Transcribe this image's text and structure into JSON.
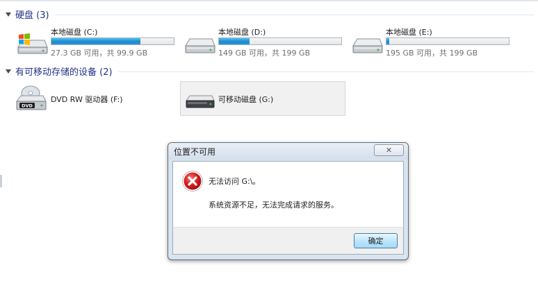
{
  "groups": {
    "hard_disks": {
      "label": "硬盘 (3)"
    },
    "removable": {
      "label": "有可移动存储的设备 (2)"
    }
  },
  "drives": [
    {
      "name": "本地磁盘 (C:)",
      "size": "27.3 GB 可用，共 99.9 GB",
      "used_fraction": 0.73,
      "icon": "windows-drive-icon"
    },
    {
      "name": "本地磁盘 (D:)",
      "size": "149 GB 可用，共 199 GB",
      "used_fraction": 0.25,
      "icon": "hard-drive-icon"
    },
    {
      "name": "本地磁盘 (E:)",
      "size": "195 GB 可用，共 199 GB",
      "used_fraction": 0.02,
      "icon": "hard-drive-icon"
    }
  ],
  "devices": [
    {
      "name": "DVD RW 驱动器 (F:)",
      "icon": "dvd-drive-icon",
      "icon_label": "DVD"
    },
    {
      "name": "可移动磁盘 (G:)",
      "icon": "removable-drive-icon"
    }
  ],
  "dialog": {
    "title": "位置不可用",
    "close_icon": "close-icon",
    "icon": "error-icon",
    "message": "无法访问 G:\\。",
    "detail": "系统资源不足，无法完成请求的服务。",
    "ok_label": "确定"
  },
  "colors": {
    "accent": "#1e3287",
    "bar_fill": "#1a8ad1",
    "error": "#c8141e"
  }
}
